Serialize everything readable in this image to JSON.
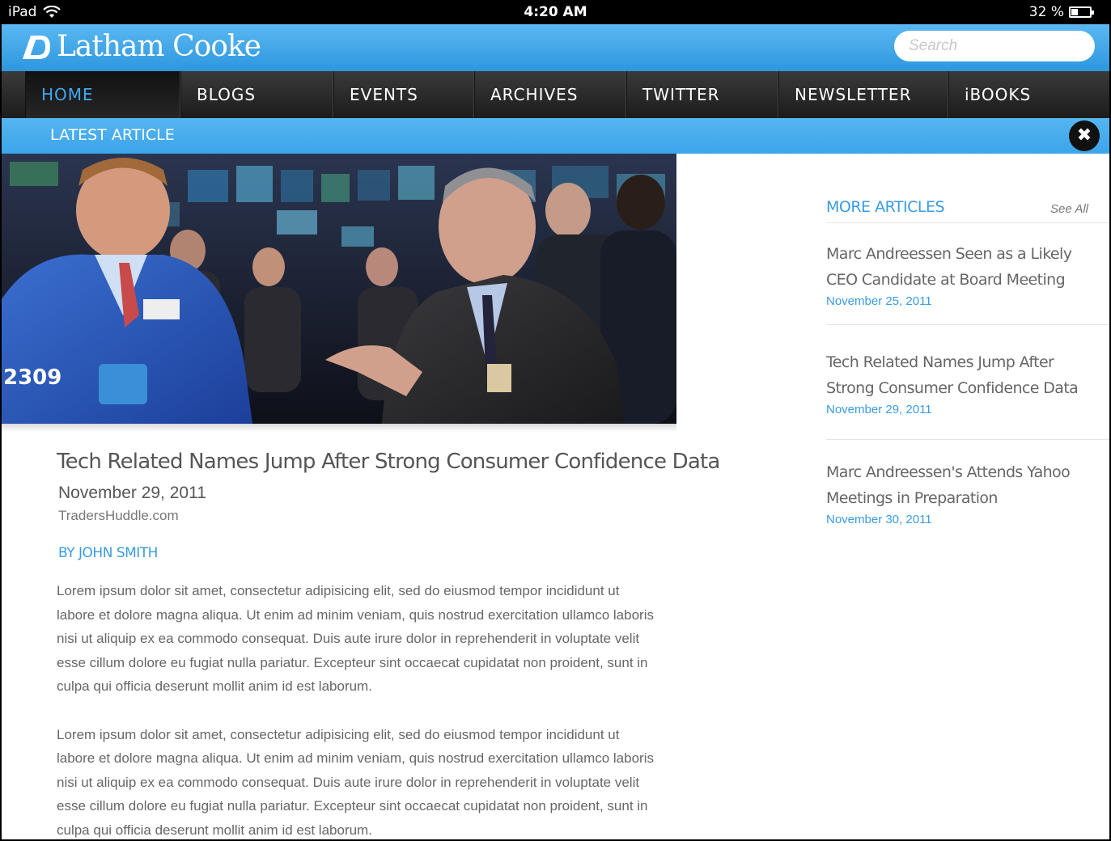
{
  "status_bar": {
    "device": "iPad",
    "time": "4:20 AM",
    "battery": "32 %",
    "battery_level": 0.32
  },
  "header": {
    "brand": "Latham Cooke",
    "search_placeholder": "Search"
  },
  "nav": {
    "items": [
      {
        "label": "HOME"
      },
      {
        "label": "BLOGS"
      },
      {
        "label": "EVENTS"
      },
      {
        "label": "ARCHIVES"
      },
      {
        "label": "TWITTER"
      },
      {
        "label": "NEWSLETTER"
      },
      {
        "label": "iBOOKS"
      }
    ],
    "active": "HOME"
  },
  "latest_bar": {
    "label": "LATEST ARTICLE"
  },
  "article": {
    "title": "Tech Related Names Jump After Strong Consumer Confidence Data",
    "date": "November 29, 2011",
    "source": "TradersHuddle.com",
    "byline": "BY JOHN SMITH",
    "paragraphs": [
      "Lorem ipsum dolor sit amet, consectetur adipisicing elit, sed do eiusmod tempor incididunt ut labore et dolore magna aliqua. Ut enim ad minim veniam, quis nostrud exercitation ullamco laboris nisi ut aliquip ex ea commodo consequat. Duis aute irure dolor in reprehenderit in voluptate velit esse cillum dolore eu fugiat nulla pariatur. Excepteur sint occaecat cupidatat non proident, sunt in culpa qui officia deserunt mollit anim id est laborum.",
      "Lorem ipsum dolor sit amet, consectetur adipisicing elit, sed do eiusmod tempor incididunt ut labore et dolore magna aliqua. Ut enim ad minim veniam, quis nostrud exercitation ullamco laboris nisi ut aliquip ex ea commodo consequat. Duis aute irure dolor in reprehenderit in voluptate velit esse cillum dolore eu fugiat nulla pariatur. Excepteur sint occaecat cupidatat non proident, sunt in culpa qui officia deserunt mollit anim id est laborum."
    ],
    "photo_badge": "2309"
  },
  "sidebar": {
    "title": "MORE ARTICLES",
    "see_all": "See All",
    "items": [
      {
        "title": "Marc Andreessen Seen as a Likely CEO Candidate at Board Meeting",
        "date": "November 25, 2011"
      },
      {
        "title": "Tech Related Names Jump After Strong Consumer Confidence Data",
        "date": "November 29, 2011"
      },
      {
        "title": "Marc Andreessen's Attends Yahoo Meetings in Preparation",
        "date": "November 30, 2011"
      }
    ]
  },
  "colors": {
    "accent_blue": "#3a9be2",
    "header_blue": "#4aaeee",
    "nav_dark": "#262626"
  }
}
